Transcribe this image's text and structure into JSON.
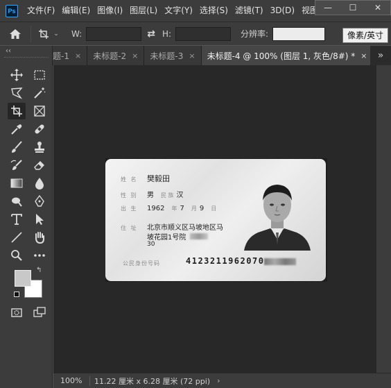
{
  "app": {
    "logo_text": "Ps"
  },
  "menu": [
    "文件(F)",
    "编辑(E)",
    "图像(I)",
    "图层(L)",
    "文字(Y)",
    "选择(S)",
    "滤镜(T)",
    "3D(D)",
    "视图"
  ],
  "window_controls": {
    "minimize": "—",
    "maximize": "☐",
    "close": "✕"
  },
  "options_bar": {
    "w_label": "W:",
    "w_value": "",
    "swap_glyph": "⇄",
    "h_label": "H:",
    "h_value": "",
    "resolution_label": "分辨率:",
    "resolution_value": "",
    "unit_tooltip": "像素/英寸"
  },
  "tabs": [
    {
      "label": "题-1",
      "close": "×",
      "active": false
    },
    {
      "label": "未标题-2",
      "close": "×",
      "active": false
    },
    {
      "label": "未标题-3",
      "close": "×",
      "active": false
    },
    {
      "label": "未标题-4 @ 100% (图层 1, 灰色/8#) *",
      "close": "×",
      "active": true
    }
  ],
  "tab_overflow": "»",
  "toolbox": {
    "collapse": "‹‹"
  },
  "colors": {
    "foreground": "#c8c8c8",
    "background": "#ffffff",
    "workspace": "#282828",
    "ui_dark": "#3c3c3c"
  },
  "id_card": {
    "name_label": "姓 名",
    "name": "樊毅田",
    "sex_label": "性 别",
    "sex": "男",
    "ethnicity_label": "民 族",
    "ethnicity": "汉",
    "birth_label": "出 生",
    "birth_year": "1962",
    "birth_year_unit": "年",
    "birth_month": "7",
    "birth_month_unit": "月",
    "birth_day": "9",
    "birth_day_unit": "日",
    "address_label": "住 址",
    "address_line1": "北京市顺义区马坡地区马",
    "address_line2": "坡花园1号院",
    "address_line3": "30",
    "id_label": "公民身份号码",
    "id_number": "4123211962070"
  },
  "status_bar": {
    "zoom": "100%",
    "doc_info": "11.22 厘米 x 6.28 厘米 (72 ppi)",
    "arrow": "›"
  }
}
